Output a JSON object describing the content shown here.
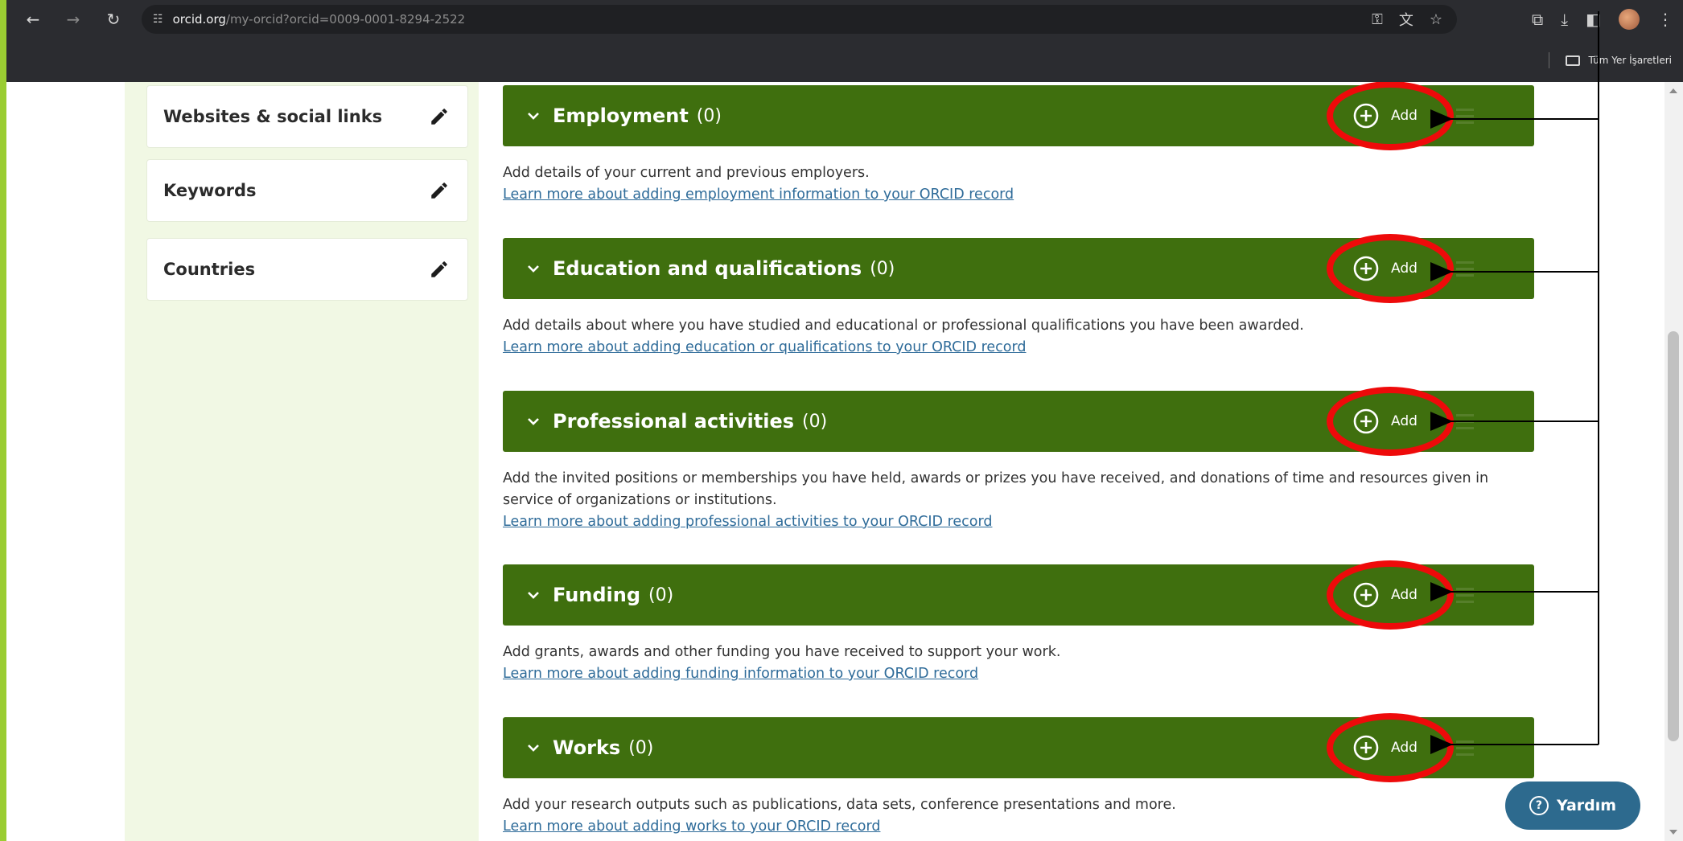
{
  "browser": {
    "url_host": "orcid.org",
    "url_path": "/my-orcid?orcid=0009-0001-8294-2522",
    "bookmarks_label": "Tüm Yer İşaretleri"
  },
  "sidebar": {
    "items": [
      {
        "label": "Websites & social links"
      },
      {
        "label": "Keywords"
      },
      {
        "label": "Countries"
      }
    ]
  },
  "sections": [
    {
      "title": "Employment",
      "count": "(0)",
      "add_label": "Add",
      "desc": "Add details of your current and previous employers.",
      "link": "Learn more about adding employment information to your ORCID record"
    },
    {
      "title": "Education and qualifications",
      "count": "(0)",
      "add_label": "Add",
      "desc": "Add details about where you have studied and educational or professional qualifications you have been awarded.",
      "link": "Learn more about adding education or qualifications to your ORCID record"
    },
    {
      "title": "Professional activities",
      "count": "(0)",
      "add_label": "Add",
      "desc": "Add the invited positions or memberships you have held, awards or prizes you have received, and donations of time and resources given in service of organizations or institutions.",
      "link": "Learn more about adding professional activities to your ORCID record"
    },
    {
      "title": "Funding",
      "count": "(0)",
      "add_label": "Add",
      "desc": "Add grants, awards and other funding you have received to support your work.",
      "link": "Learn more about adding funding information to your ORCID record"
    },
    {
      "title": "Works",
      "count": "(0)",
      "add_label": "Add",
      "desc": "Add your research outputs such as publications, data sets, conference presentations and more.",
      "link": "Learn more about adding works to your ORCID record"
    }
  ],
  "help_button": {
    "label": "Yardım"
  },
  "colors": {
    "section_header": "#3f6f0e",
    "highlight": "#ee0a0a",
    "sidebar_bg": "#f1f8e4",
    "frame": "#9ACD32",
    "link": "#2e6b99"
  },
  "icons": {
    "back": "arrow-left-icon",
    "forward": "arrow-right-icon",
    "reload": "reload-icon",
    "edit": "pencil-icon",
    "add": "plus-circle-icon",
    "expand": "chevron-down-icon"
  }
}
